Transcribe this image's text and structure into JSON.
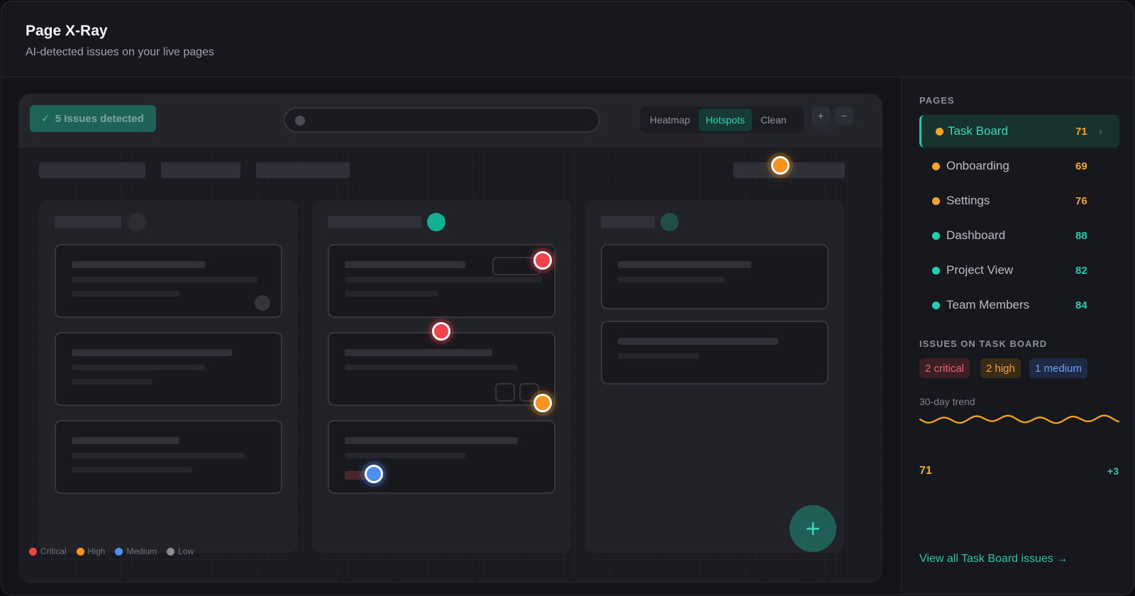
{
  "header": {
    "title": "Page X-Ray",
    "subtitle": "AI-detected issues on your live pages"
  },
  "preview": {
    "issues_pill": "5 Issues detected",
    "view_modes": [
      {
        "label": "Heatmap",
        "active": false
      },
      {
        "label": "Hotspots",
        "active": true
      },
      {
        "label": "Clean",
        "active": false
      }
    ],
    "zoom_in_label": "+",
    "zoom_out_label": "−",
    "fab_label": "+",
    "hotspots": [
      "high",
      "critical",
      "critical",
      "high",
      "medium"
    ],
    "legend": [
      {
        "label": "Critical",
        "color": "#f2434b"
      },
      {
        "label": "High",
        "color": "#f7931a"
      },
      {
        "label": "Medium",
        "color": "#4b8ef4"
      },
      {
        "label": "Low",
        "color": "#8a8d94"
      }
    ]
  },
  "sidebar": {
    "pages_heading": "PAGES",
    "pages": [
      {
        "name": "Task Board",
        "score": "71",
        "color": "#f7a52a",
        "active": true
      },
      {
        "name": "Onboarding",
        "score": "69",
        "color": "#f7a52a",
        "active": false
      },
      {
        "name": "Settings",
        "score": "76",
        "color": "#f7a52a",
        "active": false
      },
      {
        "name": "Dashboard",
        "score": "88",
        "color": "#1fcfae",
        "active": false
      },
      {
        "name": "Project View",
        "score": "82",
        "color": "#1fcfae",
        "active": false
      },
      {
        "name": "Team Members",
        "score": "84",
        "color": "#1fcfae",
        "active": false
      }
    ],
    "issues_heading": "ISSUES ON TASK BOARD",
    "chips": {
      "critical": "2 critical",
      "high": "2 high",
      "medium": "1 medium"
    },
    "trend_label": "30-day trend",
    "trend_value": "71",
    "trend_delta": "+3",
    "view_all": "View all Task Board issues →"
  }
}
